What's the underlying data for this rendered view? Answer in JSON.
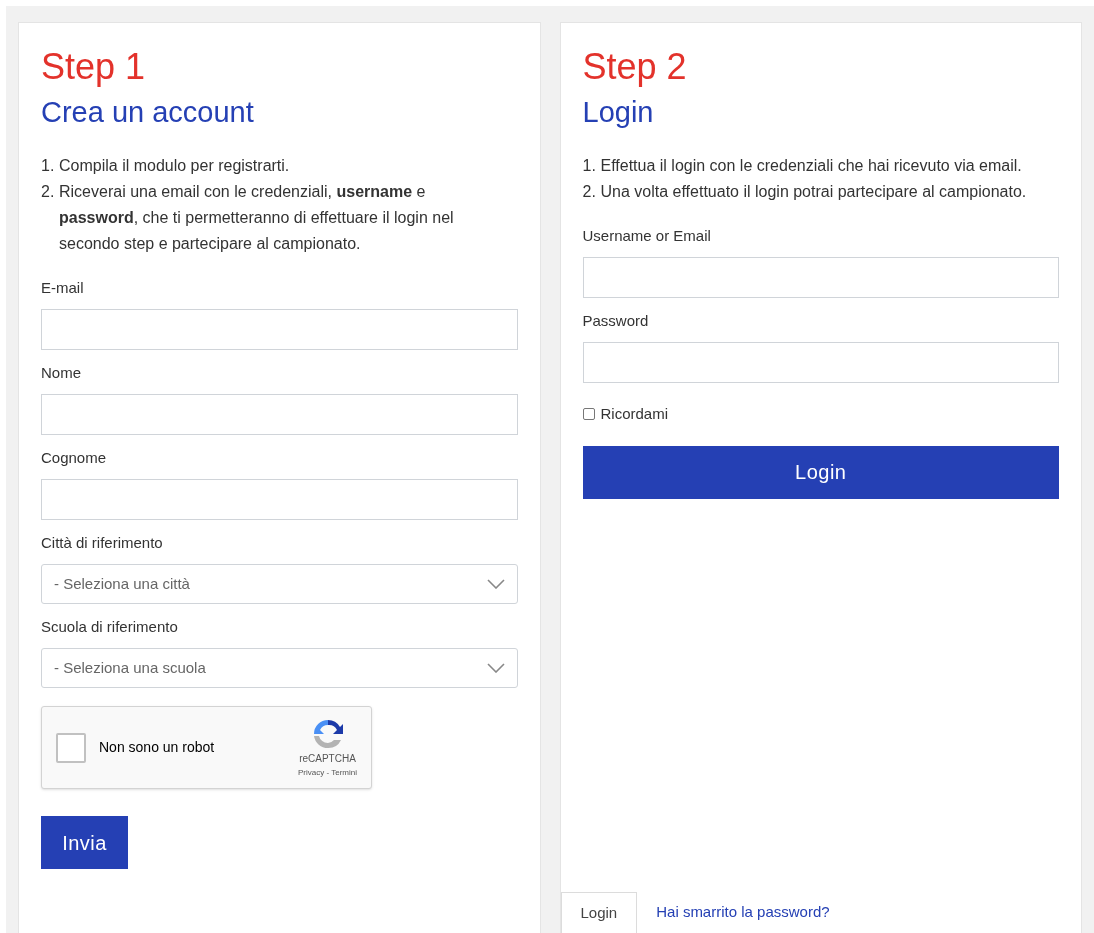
{
  "register": {
    "step": "Step 1",
    "title": "Crea un account",
    "instructions": [
      {
        "number": "1.",
        "text": "Compila il modulo per registrarti."
      },
      {
        "number": "2.",
        "text": "Riceverai una email con le credenziali, **username** e **password**, che ti permetteranno di effettuare il login nel secondo step e partecipare al campionato."
      }
    ],
    "fields": [
      {
        "kind": "text",
        "label": "E-mail"
      },
      {
        "kind": "text",
        "label": "Nome"
      },
      {
        "kind": "text",
        "label": "Cognome"
      },
      {
        "kind": "select",
        "label": "Città di riferimento",
        "placeholder": "- Seleziona una città"
      },
      {
        "kind": "select",
        "label": "Scuola di riferimento",
        "placeholder": "- Seleziona una scuola"
      }
    ],
    "captcha": {
      "label": "Non sono un robot",
      "checked": false,
      "brand": "reCAPTCHA",
      "links": "Privacy - Termini"
    },
    "submit": "Invia"
  },
  "login": {
    "step": "Step 2",
    "title": "Login",
    "instructions": [
      {
        "number": "1.",
        "text": "Effettua il login con le credenziali che hai ricevuto via email."
      },
      {
        "number": "2.",
        "text": "Una volta effettuato il login potrai partecipare al campionato."
      }
    ],
    "fields": [
      {
        "kind": "text",
        "label": "Username or Email"
      },
      {
        "kind": "text",
        "label": "Password"
      }
    ],
    "remember": {
      "label": "Ricordami",
      "checked": false
    },
    "submit": "Login",
    "tabs": [
      {
        "label": "Login",
        "selected": true
      }
    ],
    "link": "Hai smarrito la password?"
  }
}
